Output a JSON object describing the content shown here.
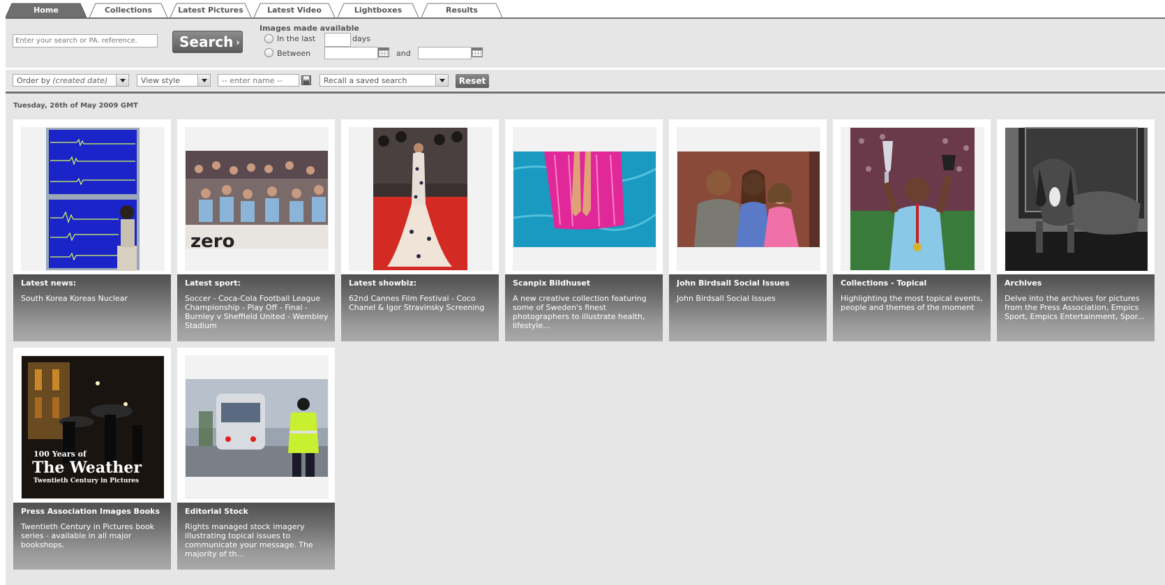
{
  "tabs": [
    {
      "label": "Home",
      "active": true
    },
    {
      "label": "Collections",
      "active": false
    },
    {
      "label": "Latest Pictures",
      "active": false
    },
    {
      "label": "Latest Video",
      "active": false
    },
    {
      "label": "Lightboxes",
      "active": false
    },
    {
      "label": "Results",
      "active": false
    }
  ],
  "search": {
    "placeholder": "Enter your search or PA. reference.",
    "button_label": "Search",
    "available_title": "Images made available",
    "in_the_last_label": "In the last",
    "days_label": "days",
    "between_label": "Between",
    "and_label": "and"
  },
  "options": {
    "order_by_label": "Order by",
    "order_by_value": "(created date)",
    "view_style_label": "View style",
    "name_placeholder": "-- enter name --",
    "recall_label": "Recall a saved search",
    "reset_label": "Reset"
  },
  "content": {
    "date_heading": "Tuesday, 26th of May 2009 GMT",
    "cards": [
      {
        "title": "Latest news:",
        "desc": "South Korea Koreas Nuclear"
      },
      {
        "title": "Latest sport:",
        "desc": "Soccer - Coca-Cola Football League Championship - Play Off - Final - Burnley v Sheffield United - Wembley Stadium"
      },
      {
        "title": "Latest showbiz:",
        "desc": "62nd Cannes Film Festival - Coco Chanel & Igor Stravinsky Screening"
      },
      {
        "title": "Scanpix Bildhuset",
        "desc": "A new creative collection featuring some of Sweden's finest photographers to illustrate health, lifestyle..."
      },
      {
        "title": "John Birdsall Social Issues",
        "desc": "John Birdsall Social Issues"
      },
      {
        "title": "Collections - Topical",
        "desc": "Highlighting the most topical events, people and themes of the moment"
      },
      {
        "title": "Archives",
        "desc": "Delve into the archives for pictures from the Press Association, Empics Sport, Empics Entertainment, Spor..."
      },
      {
        "title": "Press Association Images Books",
        "desc": "Twentieth Century in Pictures book series - available in all major bookshops."
      },
      {
        "title": "Editorial Stock",
        "desc": "Rights managed stock imagery illustrating topical issues to communicate your message. The majority of th..."
      }
    ],
    "book_cover": {
      "line1": "100 Years of",
      "line2": "The Weather",
      "line3": "Twentieth Century in Pictures"
    },
    "banner_text": "zero"
  }
}
